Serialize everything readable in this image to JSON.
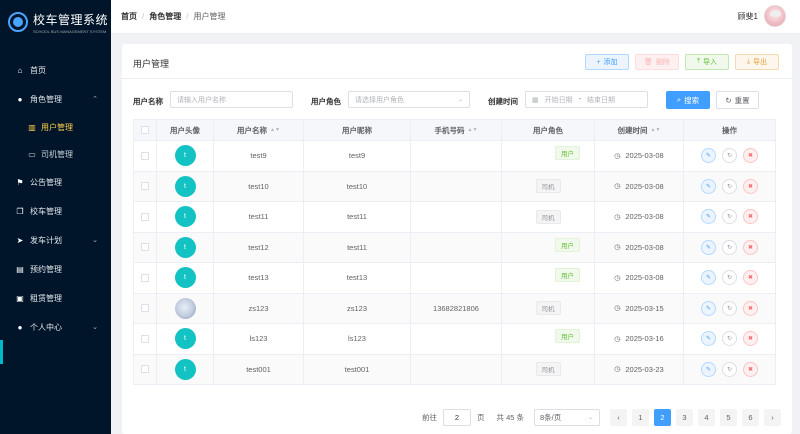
{
  "sidebar": {
    "title": "校车管理系统",
    "subtitle": "SCHOOL BUS MANAGEMENT SYSTEM",
    "menu": {
      "home": "首页",
      "role": "角色管理",
      "role_user": "用户管理",
      "role_driver": "司机管理",
      "notice": "公告管理",
      "bus": "校车管理",
      "plan": "发车计划",
      "booking": "预约管理",
      "rent": "租赁管理",
      "profile": "个人中心"
    }
  },
  "header": {
    "crumb_home": "首页",
    "crumb_role": "角色管理",
    "crumb_current": "用户管理",
    "username": "顾斐1"
  },
  "card": {
    "title": "用户管理",
    "btn_add": "添加",
    "btn_delete": "删除",
    "btn_import": "导入",
    "btn_export": "导出"
  },
  "search": {
    "name_label": "用户名称",
    "name_placeholder": "请输入用户名称",
    "role_label": "用户角色",
    "role_placeholder": "请选择用户角色",
    "time_label": "创建时间",
    "start_placeholder": "开始日期",
    "range_sep": "-",
    "end_placeholder": "结束日期",
    "btn_search": "搜索",
    "btn_reset": "重置"
  },
  "table": {
    "headers": {
      "avatar": "用户头像",
      "username": "用户名称",
      "nickname": "用户昵称",
      "phone": "手机号码",
      "role": "用户角色",
      "created": "创建时间",
      "ops": "操作"
    },
    "rows": [
      {
        "avatar": "t",
        "username": "test9",
        "nickname": "test9",
        "phone": "",
        "role": "用户",
        "role_type": "user",
        "created": "2025-03-08"
      },
      {
        "avatar": "t",
        "username": "test10",
        "nickname": "test10",
        "phone": "",
        "role": "司机",
        "role_type": "driver",
        "created": "2025-03-08"
      },
      {
        "avatar": "t",
        "username": "test11",
        "nickname": "test11",
        "phone": "",
        "role": "司机",
        "role_type": "driver",
        "created": "2025-03-08"
      },
      {
        "avatar": "t",
        "username": "test12",
        "nickname": "test11",
        "phone": "",
        "role": "用户",
        "role_type": "user",
        "created": "2025-03-08"
      },
      {
        "avatar": "t",
        "username": "test13",
        "nickname": "test13",
        "phone": "",
        "role": "用户",
        "role_type": "user",
        "created": "2025-03-08"
      },
      {
        "avatar": "",
        "username": "zs123",
        "nickname": "zs123",
        "phone": "13682821806",
        "role": "司机",
        "role_type": "driver",
        "created": "2025-03-15"
      },
      {
        "avatar": "t",
        "username": "ls123",
        "nickname": "ls123",
        "phone": "",
        "role": "用户",
        "role_type": "user",
        "created": "2025-03-16"
      },
      {
        "avatar": "t",
        "username": "test001",
        "nickname": "test001",
        "phone": "",
        "role": "司机",
        "role_type": "driver",
        "created": "2025-03-23"
      }
    ]
  },
  "pagination": {
    "goto_prefix": "前往",
    "goto_value": "2",
    "goto_suffix": "页",
    "total": "共 45 条",
    "page_size": "8条/页",
    "prev": "‹",
    "next": "›",
    "pages": [
      "1",
      "2",
      "3",
      "4",
      "5",
      "6"
    ],
    "current": "2"
  },
  "colors": {
    "sidebar_bg": "#001529",
    "primary": "#409eff",
    "active_menu": "#ffd04b",
    "avatar_bg": "#13c2c2"
  }
}
